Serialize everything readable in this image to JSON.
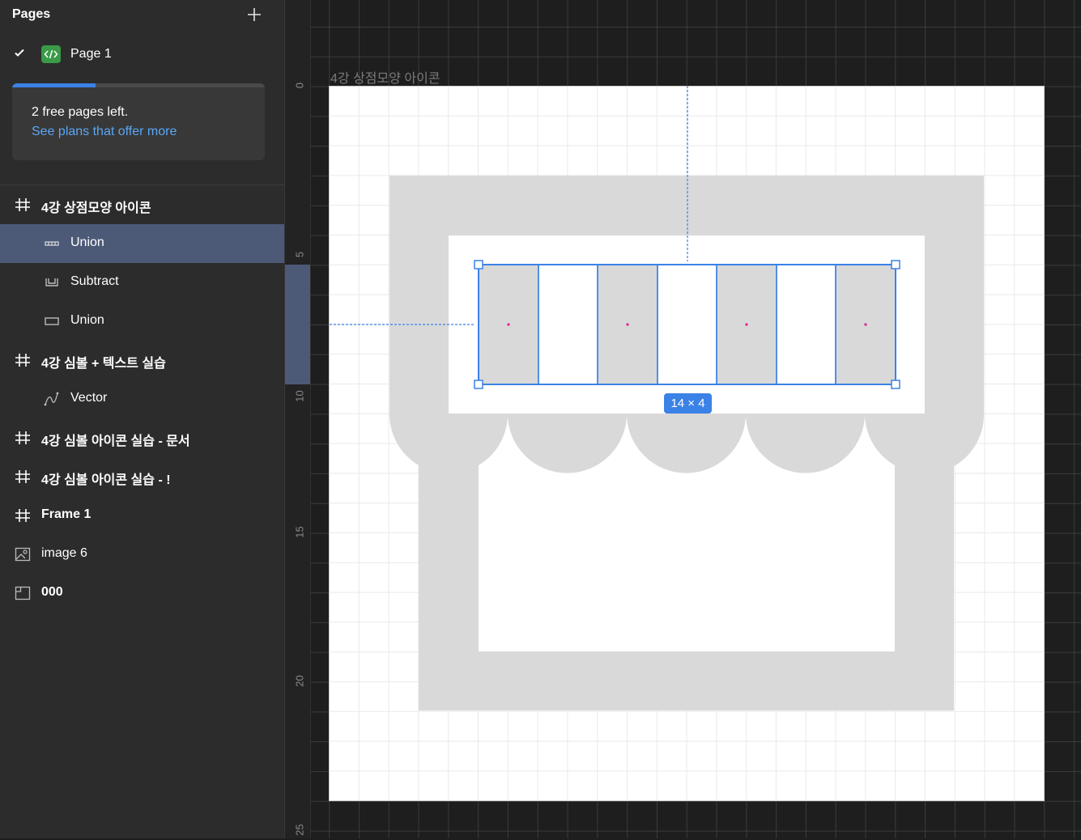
{
  "sidebar": {
    "title": "Pages",
    "add_icon": "plus-icon",
    "current_page": {
      "name": "Page 1",
      "icon": "code-page-icon",
      "check_icon": "check-icon"
    },
    "notice": {
      "line1": "2 free pages left.",
      "link": "See plans that offer more",
      "progress": 0.33,
      "accent": "#3b82e6"
    },
    "layers": [
      {
        "name": "4강 상점모양 아이콘",
        "icon": "frame-hash-icon",
        "bold": true,
        "selected": false
      },
      {
        "name": "Union",
        "icon": "union-grid-icon",
        "bold": false,
        "selected": true
      },
      {
        "name": "Subtract",
        "icon": "subtract-icon",
        "bold": false,
        "selected": false
      },
      {
        "name": "Union",
        "icon": "rectangle-union-icon",
        "bold": false,
        "selected": false
      },
      {
        "name": "4강 심볼 + 텍스트 실습",
        "icon": "frame-hash-icon",
        "bold": true,
        "selected": false
      },
      {
        "name": "Vector",
        "icon": "vector-pen-icon",
        "bold": false,
        "selected": false
      },
      {
        "name": "4강 심볼 아이콘 실습 - 문서",
        "icon": "frame-hash-icon",
        "bold": true,
        "selected": false
      },
      {
        "name": "4강 심볼 아이콘 실습 - !",
        "icon": "frame-hash-icon",
        "bold": true,
        "selected": false
      },
      {
        "name": "Frame 1",
        "icon": "frame-hash-icon",
        "bold": true,
        "selected": false
      },
      {
        "name": "image 6",
        "icon": "image-icon",
        "bold": false,
        "selected": false
      },
      {
        "name": "000",
        "icon": "section-icon",
        "bold": true,
        "selected": false
      }
    ]
  },
  "canvas": {
    "frame_label": "4강 상점모양 아이콘",
    "selection_size": "14 × 4",
    "ruler_ticks": [
      "0",
      "5",
      "10",
      "15",
      "20",
      "25"
    ],
    "selection_color": "#3b82e6",
    "shape_color": "#d9d9d9"
  }
}
